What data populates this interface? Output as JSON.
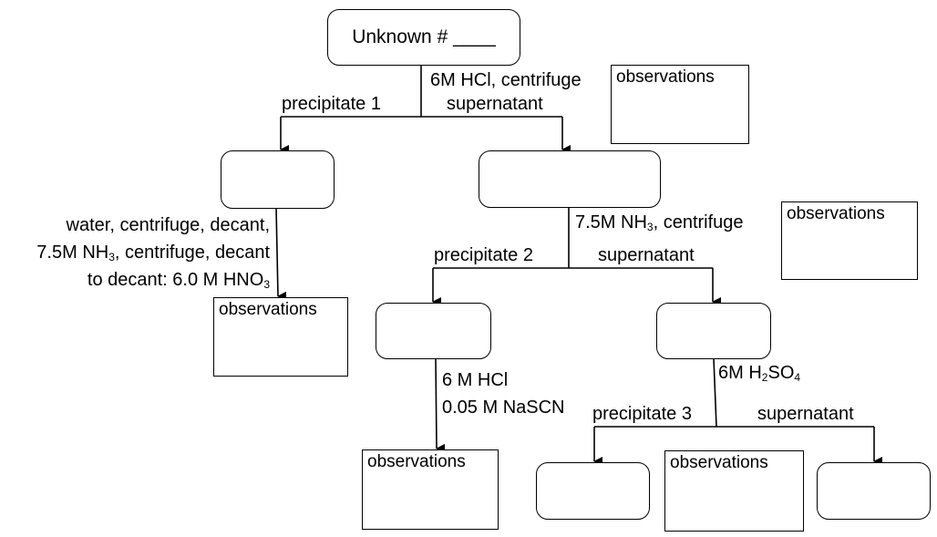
{
  "start_box": {
    "label": "Unknown # ____"
  },
  "observation_label": "observations",
  "step1": {
    "reagent": "6M HCl, centrifuge",
    "left_branch": "precipitate 1",
    "right_branch": "supernatant"
  },
  "precipitate1_path": {
    "line1": "water, centrifuge, decant,",
    "line2_prefix": "7.5M NH",
    "line2_sub": "3",
    "line2_suffix": ", centrifuge, decant",
    "line3_prefix": "to decant:  6.0 M HNO",
    "line3_sub": "3"
  },
  "step2": {
    "reagent_prefix": "7.5M NH",
    "reagent_sub": "3",
    "reagent_suffix": ", centrifuge",
    "left_branch": "precipitate 2",
    "right_branch": "supernatant"
  },
  "precipitate2_path": {
    "line1": "6 M HCl",
    "line2": "0.05 M NaSCN"
  },
  "step3": {
    "reagent_prefix": "6M H",
    "reagent_sub1": "2",
    "reagent_mid": "SO",
    "reagent_sub2": "4",
    "left_branch": "precipitate 3",
    "right_branch": "supernatant"
  }
}
